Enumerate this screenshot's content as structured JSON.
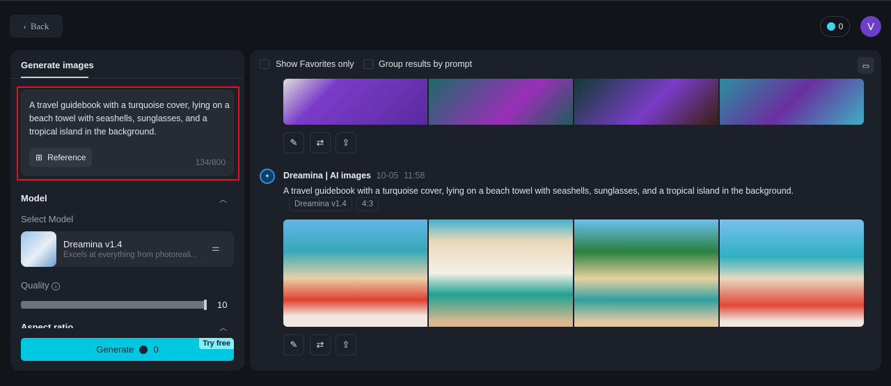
{
  "header": {
    "back_label": "Back",
    "credits": "0",
    "avatar_initial": "V"
  },
  "left_panel": {
    "tab": "Generate images",
    "prompt_text": "A travel guidebook with a turquoise cover, lying on a beach towel with seashells, sunglasses, and a tropical island in the background.",
    "reference_label": "Reference",
    "char_count": "134/800",
    "model_section": "Model",
    "select_model_label": "Select Model",
    "model_name": "Dreamina v1.4",
    "model_desc": "Excels at everything from photoreali...",
    "quality_label": "Quality",
    "quality_value": "10",
    "quality_fraction": 1.0,
    "aspect_label": "Aspect ratio",
    "generate_label": "Generate",
    "generate_cost": "0",
    "try_free": "Try free"
  },
  "main": {
    "show_favorites": "Show Favorites only",
    "group_results": "Group results by prompt",
    "result": {
      "author": "Dreamina | AI images",
      "date": "10-05",
      "time": "11:58",
      "prompt": "A travel guidebook with a turquoise cover, lying on a beach towel with seashells, sunglasses, and a tropical island in the background.",
      "model_tag": "Dreamina v1.4",
      "ratio_tag": "4:3"
    }
  },
  "colors": {
    "accent": "#00c8e0",
    "highlight_box": "#e0141e",
    "avatar": "#6c3ec9"
  }
}
